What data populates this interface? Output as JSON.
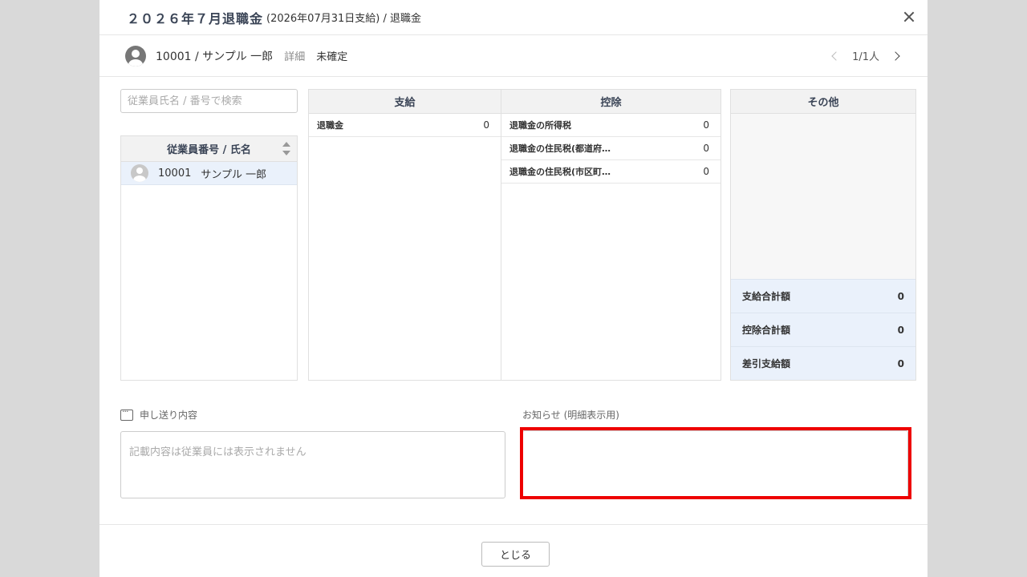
{
  "header": {
    "title": "２０２６年７月退職金",
    "subtitle": "(2026年07月31日支給) / 退職金"
  },
  "employee_bar": {
    "employee": "10001 / サンプル 一郎",
    "detail_link": "詳細",
    "status": "未確定",
    "pager": "1/1人"
  },
  "search": {
    "placeholder": "従業員氏名 / 番号で検索"
  },
  "employee_list": {
    "header": "従業員番号 / 氏名",
    "rows": [
      {
        "number": "10001",
        "name": "サンプル 一郎"
      }
    ]
  },
  "payments": {
    "header": "支給",
    "items": [
      {
        "label": "退職金",
        "value": "0"
      }
    ]
  },
  "deductions": {
    "header": "控除",
    "items": [
      {
        "label": "退職金の所得税",
        "value": "0"
      },
      {
        "label": "退職金の住民税(都道府…",
        "value": "0"
      },
      {
        "label": "退職金の住民税(市区町…",
        "value": "0"
      }
    ]
  },
  "other": {
    "header": "その他",
    "totals": [
      {
        "label": "支給合計額",
        "value": "0"
      },
      {
        "label": "控除合計額",
        "value": "0"
      },
      {
        "label": "差引支給額",
        "value": "0"
      }
    ]
  },
  "memo": {
    "label": "申し送り内容",
    "placeholder": "記載内容は従業員には表示されません",
    "value": ""
  },
  "notice": {
    "label": "お知らせ (明細表示用)",
    "value": ""
  },
  "footer": {
    "close_label": "とじる"
  },
  "colors": {
    "highlight": "#ee0000",
    "selected_row": "#eaf1fb",
    "heading": "#3a4456"
  }
}
